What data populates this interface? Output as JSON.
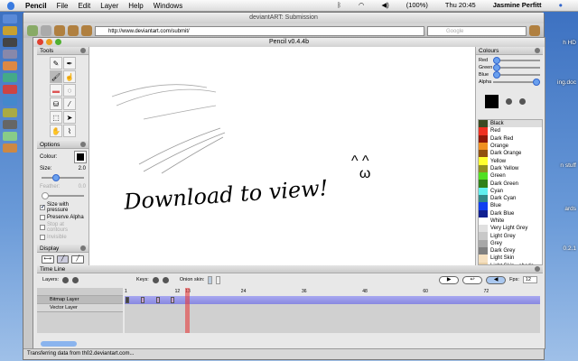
{
  "menubar": {
    "app": "Pencil",
    "items": [
      "File",
      "Edit",
      "Layer",
      "Help",
      "Windows"
    ],
    "battery": "(100%)",
    "clock": "Thu 20:45",
    "user": "Jasmine Perfitt"
  },
  "desktop": [
    "h HD",
    "ing.doc",
    "n stuff",
    "ards",
    "0.2.1"
  ],
  "browser": {
    "title": "deviantART: Submission",
    "url": "http://www.deviantart.com/submit/",
    "search_placeholder": "Google",
    "status": "Transferring data from th02.deviantart.com..."
  },
  "pencil": {
    "title": "Pencil v0.4.4b",
    "tools": {
      "title": "Tools",
      "icons": [
        "pencil-icon",
        "pen-icon",
        "brush-icon",
        "smudge-icon",
        "eraser-icon",
        "select-lasso-icon",
        "bucket-icon",
        "eyedropper-icon",
        "select-rect-icon",
        "pointer-icon",
        "hand-icon",
        "polyline-icon"
      ]
    },
    "options": {
      "title": "Options",
      "colour_label": "Colour:",
      "size_label": "Size:",
      "size_value": "2.0",
      "size_fraction": 0.25,
      "feather_label": "Feather:",
      "feather_value": "0.0",
      "checks": [
        {
          "label": "Size with pressure",
          "checked": true
        },
        {
          "label": "Preserve Alpha",
          "checked": false
        },
        {
          "label": "Stop at contours",
          "checked": false
        },
        {
          "label": "Invisible",
          "checked": false
        }
      ]
    },
    "display": {
      "title": "Display"
    },
    "canvas": {
      "text": "Download to view!",
      "face": "^ ^\n  ω"
    },
    "colours": {
      "title": "Colours",
      "sliders": [
        {
          "label": "Red",
          "value": 0
        },
        {
          "label": "Green",
          "value": 0
        },
        {
          "label": "Blue",
          "value": 0
        },
        {
          "label": "Alpha",
          "value": 1
        }
      ],
      "list": [
        {
          "name": "Black",
          "color": "#3b4a22"
        },
        {
          "name": "Red",
          "color": "#f03020"
        },
        {
          "name": "Dark Red",
          "color": "#901808"
        },
        {
          "name": "Orange",
          "color": "#f09020"
        },
        {
          "name": "Dark Orange",
          "color": "#905010"
        },
        {
          "name": "Yellow",
          "color": "#ffff30"
        },
        {
          "name": "Dark Yellow",
          "color": "#909020"
        },
        {
          "name": "Green",
          "color": "#50e020"
        },
        {
          "name": "Dark Green",
          "color": "#308018"
        },
        {
          "name": "Cyan",
          "color": "#60f0f0"
        },
        {
          "name": "Dark Cyan",
          "color": "#308888"
        },
        {
          "name": "Blue",
          "color": "#1040f0"
        },
        {
          "name": "Dark Blue",
          "color": "#102090"
        },
        {
          "name": "White",
          "color": "#ffffff"
        },
        {
          "name": "Very Light Grey",
          "color": "#e0e0e0"
        },
        {
          "name": "Light Grey",
          "color": "#c8c8c8"
        },
        {
          "name": "Grey",
          "color": "#a8a8a8"
        },
        {
          "name": "Dark Grey",
          "color": "#808080"
        },
        {
          "name": "Light Skin",
          "color": "#f5e0c0"
        },
        {
          "name": "Light Skin - shade",
          "color": "#e8d0a8"
        }
      ]
    },
    "timeline": {
      "title": "Time Line",
      "layers_label": "Layers:",
      "keys_label": "Keys:",
      "onion_label": "Onion skin:",
      "fps_label": "Fps:",
      "fps": "12",
      "ticks": [
        "1",
        "12",
        "13",
        "24",
        "36",
        "48",
        "60",
        "72"
      ],
      "current_frame": 13,
      "keyframes": [
        1,
        4,
        7,
        10
      ],
      "layers": [
        {
          "name": "Bitmap Layer"
        },
        {
          "name": "Vector Layer"
        }
      ]
    }
  }
}
